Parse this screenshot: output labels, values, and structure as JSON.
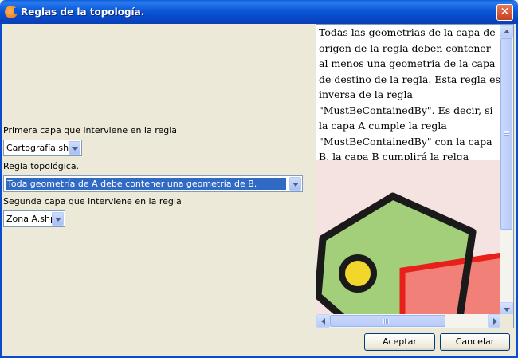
{
  "window": {
    "title": "Reglas de la topología.",
    "close_glyph": "✕"
  },
  "form": {
    "first_layer_label": "Primera capa que interviene en la regla",
    "first_layer_value": "Cartografía.shp",
    "rule_label": "Regla topológica.",
    "rule_value": "Toda geometría de A debe contener una geometría de B.",
    "second_layer_label": "Segunda capa que interviene en la regla",
    "second_layer_value": "Zona A.shp"
  },
  "description": {
    "text": "Todas las geometrias de la capa de origen de la regla deben contener al menos una geometria de la capa de destino de la regla. Esta regla es inversa de la regla \"MustBeContainedBy\". Es decir, si la capa A cumple la regla \"MustBeContainedBy\" con la capa B, la capa B cumplirá la relga \"MustContains\" con la capa A."
  },
  "buttons": {
    "accept": "Aceptar",
    "cancel": "Cancelar"
  },
  "colors": {
    "title_bar": "#0a58d6",
    "polygon_fill": "#a3cf7a",
    "polygon_stroke": "#1a1a1a",
    "point_fill": "#f2d62a",
    "rect_fill": "#f08078",
    "rect_stroke": "#e8201c",
    "figure_background": "#f4e3e0"
  },
  "icons": {
    "app": "gvsig-app-icon",
    "close": "close-icon"
  }
}
